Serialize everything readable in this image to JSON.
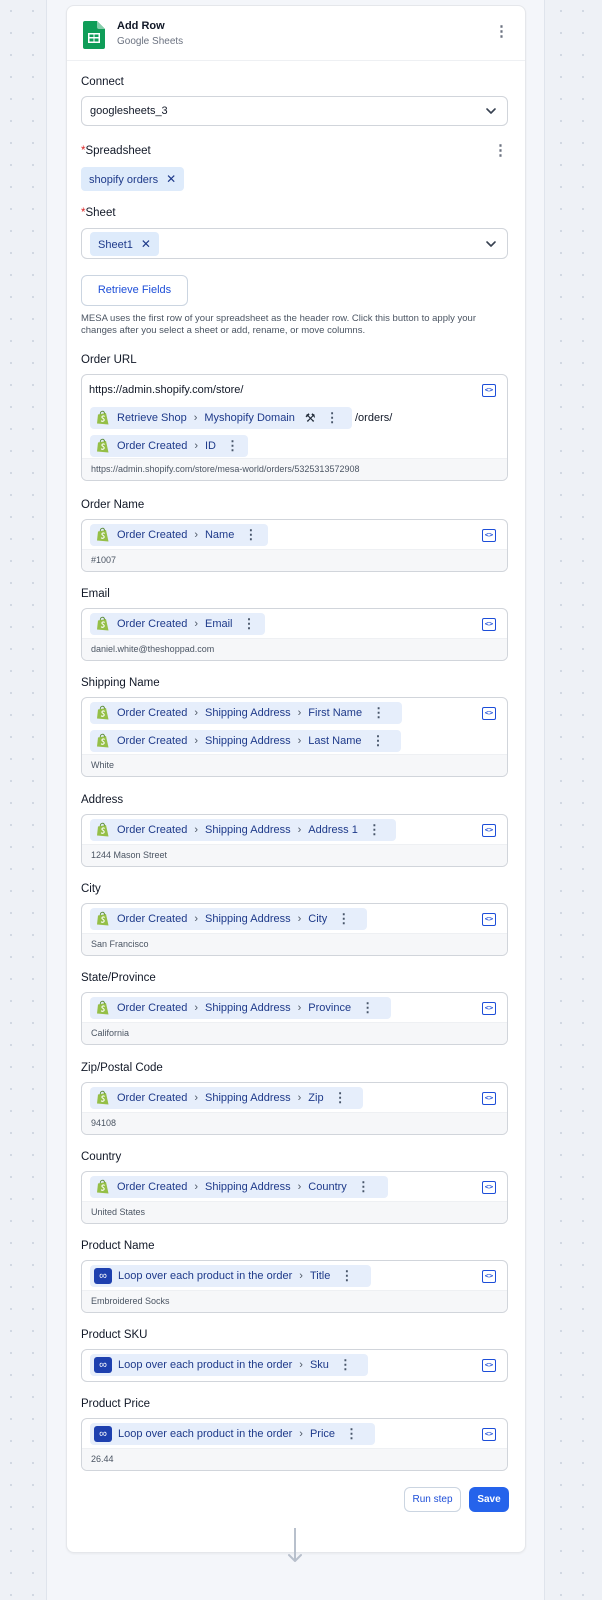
{
  "step": {
    "title": "Add Row",
    "subtitle": "Google Sheets"
  },
  "connect": {
    "label": "Connect",
    "value": "googlesheets_3"
  },
  "spreadsheet": {
    "label": "Spreadsheet",
    "chip": "shopify orders"
  },
  "sheet": {
    "label": "Sheet",
    "chip": "Sheet1"
  },
  "retrieve": {
    "button": "Retrieve Fields",
    "help": "MESA uses the first row of your spreadsheet as the header row. Click this button to apply your changes after you select a sheet or add, rename, or move columns."
  },
  "fields": {
    "order_url": {
      "label": "Order URL",
      "prefix": "https://admin.shopify.com/store/",
      "token1": [
        "Retrieve Shop",
        "Myshopify Domain"
      ],
      "suffix": "/orders/",
      "token2": [
        "Order Created",
        "ID"
      ],
      "preview": "https://admin.shopify.com/store/mesa-world/orders/5325313572908"
    },
    "order_name": {
      "label": "Order Name",
      "tokens": [
        "Order Created",
        "Name"
      ],
      "preview": "#1007"
    },
    "email": {
      "label": "Email",
      "tokens": [
        "Order Created",
        "Email"
      ],
      "preview": "daniel.white@theshoppad.com"
    },
    "shipping_name": {
      "label": "Shipping Name",
      "token1": [
        "Order Created",
        "Shipping Address",
        "First Name"
      ],
      "token2": [
        "Order Created",
        "Shipping Address",
        "Last Name"
      ],
      "preview": "White"
    },
    "address": {
      "label": "Address",
      "tokens": [
        "Order Created",
        "Shipping Address",
        "Address 1"
      ],
      "preview": "1244 Mason Street"
    },
    "city": {
      "label": "City",
      "tokens": [
        "Order Created",
        "Shipping Address",
        "City"
      ],
      "preview": "San Francisco"
    },
    "state": {
      "label": "State/Province",
      "tokens": [
        "Order Created",
        "Shipping Address",
        "Province"
      ],
      "preview": "California"
    },
    "zip": {
      "label": "Zip/Postal Code",
      "tokens": [
        "Order Created",
        "Shipping Address",
        "Zip"
      ],
      "preview": "94108"
    },
    "country": {
      "label": "Country",
      "tokens": [
        "Order Created",
        "Shipping Address",
        "Country"
      ],
      "preview": "United States"
    },
    "product_name": {
      "label": "Product Name",
      "tokens": [
        "Loop over each product in the order",
        "Title"
      ],
      "preview": "Embroidered Socks"
    },
    "product_sku": {
      "label": "Product SKU",
      "tokens": [
        "Loop over each product in the order",
        "Sku"
      ]
    },
    "product_price": {
      "label": "Product Price",
      "tokens": [
        "Loop over each product in the order",
        "Price"
      ],
      "preview": "26.44"
    }
  },
  "actions": {
    "run": "Run step",
    "save": "Save"
  },
  "icons": {
    "sheets": "google-sheets-icon",
    "shopify": "shopify-icon",
    "loop": "loop-icon",
    "code": "code-icon",
    "kebab": "kebab-icon",
    "chevron": "chevron-down-icon",
    "close": "close-icon",
    "wrench": "wrench-icon",
    "arrow": "arrow-down-icon"
  },
  "colors": {
    "accent": "#2563eb",
    "token_bg": "#e6eefb",
    "required": "#dc2626",
    "sheets_green": "#0f9d58",
    "shopify_green": "#95bf47"
  }
}
